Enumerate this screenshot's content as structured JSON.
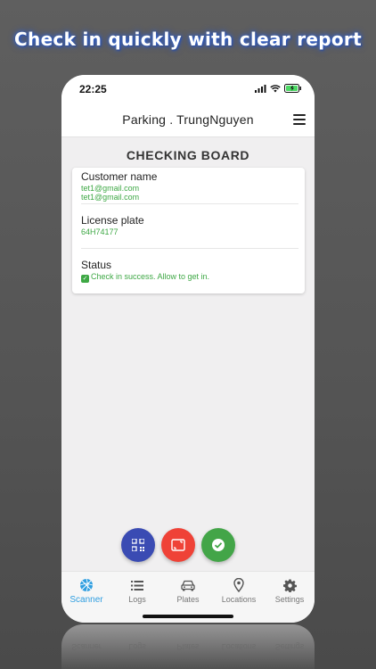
{
  "headline": "Check in quickly with clear report",
  "status_bar": {
    "time": "22:25"
  },
  "app_bar": {
    "title": "Parking . TrungNguyen"
  },
  "board": {
    "title": "CHECKING BOARD",
    "rows": [
      {
        "label": "Customer name",
        "values": [
          "tet1@gmail.com",
          "tet1@gmail.com"
        ]
      },
      {
        "label": "License plate",
        "values": [
          "64H74177"
        ]
      },
      {
        "label": "Status",
        "values": [
          "Check in success. Allow to get in."
        ]
      }
    ]
  },
  "fabs": [
    {
      "icon": "qr-code-icon",
      "color": "#3a4bb3"
    },
    {
      "icon": "plate-scan-icon",
      "color": "#ef4237"
    },
    {
      "icon": "check-icon",
      "color": "#43a548"
    }
  ],
  "tabs": [
    {
      "label": "Scanner",
      "icon": "aperture-icon",
      "active": true
    },
    {
      "label": "Logs",
      "icon": "list-icon",
      "active": false
    },
    {
      "label": "Plates",
      "icon": "car-icon",
      "active": false
    },
    {
      "label": "Locations",
      "icon": "location-pin-icon",
      "active": false
    },
    {
      "label": "Settings",
      "icon": "gear-icon",
      "active": false
    }
  ],
  "colors": {
    "accent": "#2f9ee0",
    "success": "#3ea845",
    "background": "#f0eff0"
  }
}
